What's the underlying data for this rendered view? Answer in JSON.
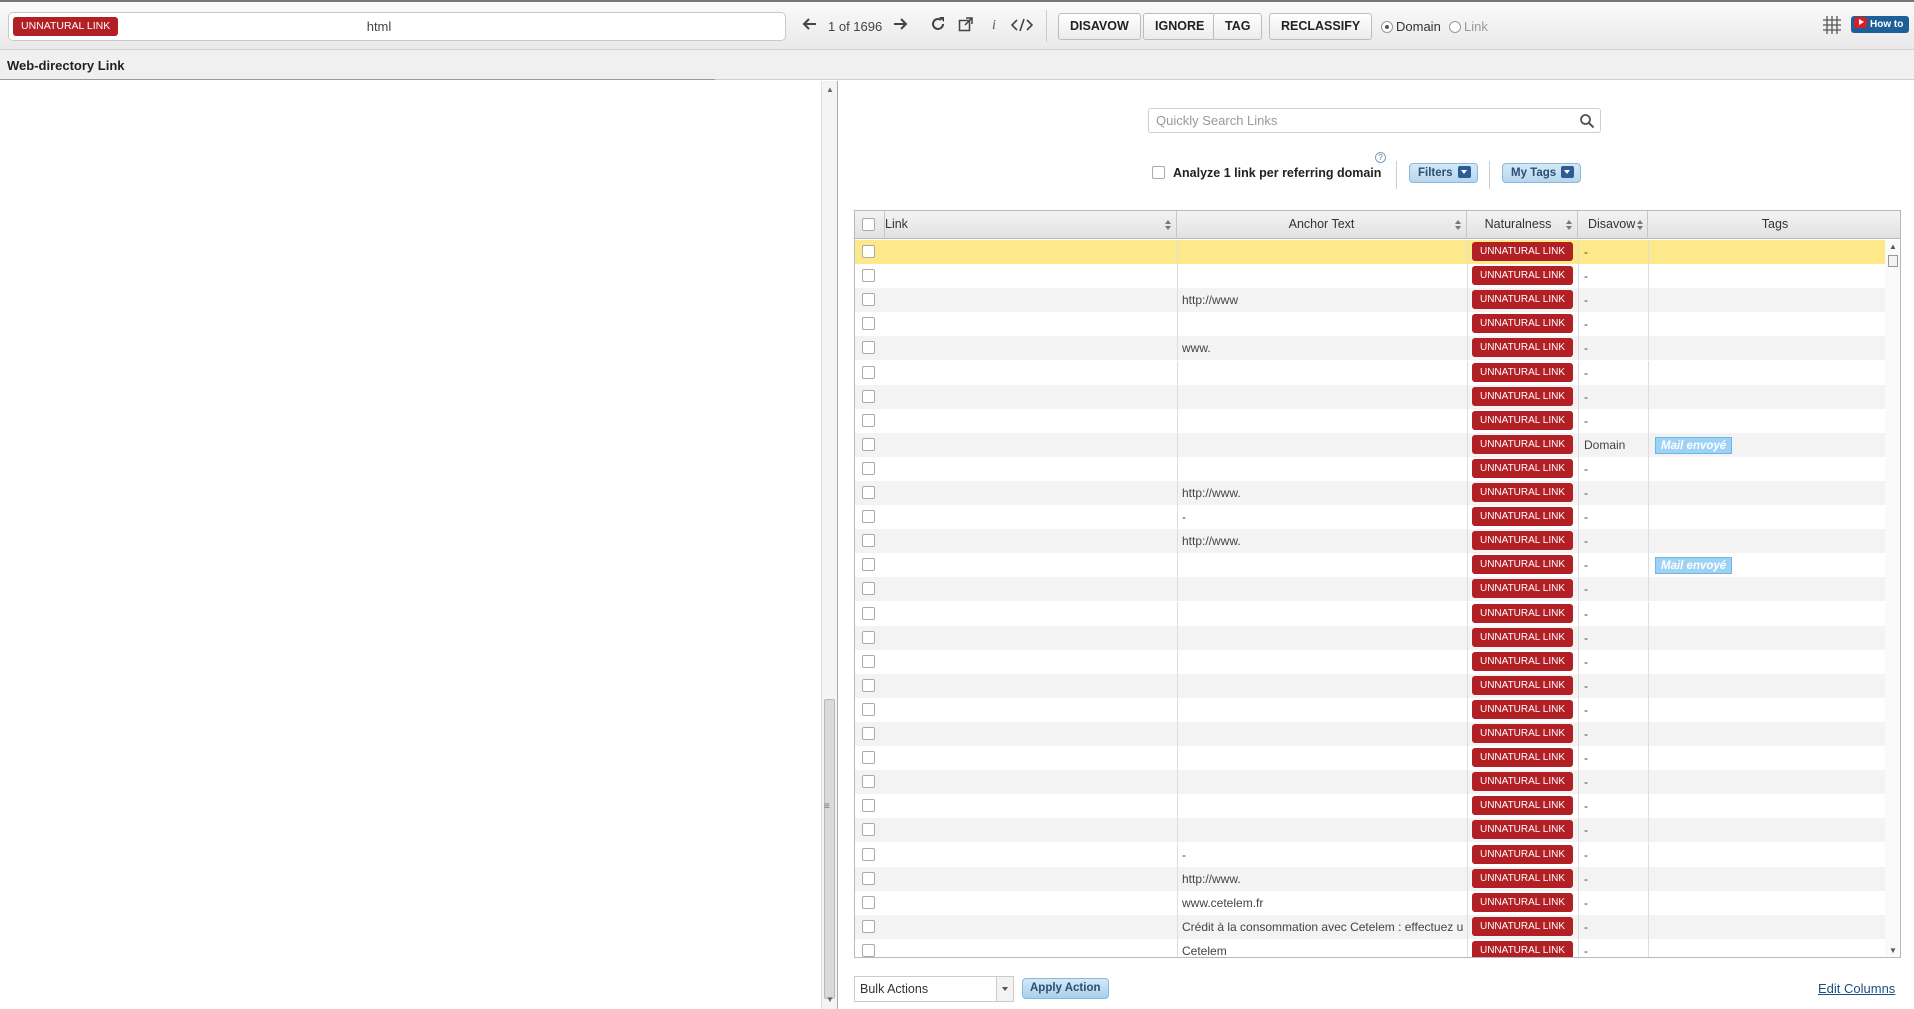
{
  "toolbar": {
    "url_badge": "UNNATURAL LINK",
    "url_text": "html",
    "pager": "1 of 1696",
    "buttons": {
      "disavow": "DISAVOW",
      "ignore": "IGNORE",
      "tag": "TAG",
      "reclassify": "RECLASSIFY"
    },
    "radio_domain": "Domain",
    "radio_link": "Link",
    "radio_selected": "Domain",
    "howto": "How to"
  },
  "subheader": {
    "title": "Web-directory Link"
  },
  "search": {
    "placeholder": "Quickly Search Links"
  },
  "filters": {
    "analyze_label": "Analyze 1 link per referring domain",
    "analyze_checked": false,
    "help": "?",
    "filters_button": "Filters",
    "mytags_button": "My Tags"
  },
  "table": {
    "columns": {
      "link": "Link",
      "anchor": "Anchor Text",
      "naturalness": "Naturalness",
      "disavow": "Disavow",
      "tags": "Tags"
    },
    "rows": [
      {
        "anchor": "",
        "naturalness": "UNNATURAL LINK",
        "disavow": "-",
        "tag": ""
      },
      {
        "anchor": "",
        "naturalness": "UNNATURAL LINK",
        "disavow": "-",
        "tag": ""
      },
      {
        "anchor": "http://www",
        "naturalness": "UNNATURAL LINK",
        "disavow": "-",
        "tag": ""
      },
      {
        "anchor": "",
        "naturalness": "UNNATURAL LINK",
        "disavow": "-",
        "tag": ""
      },
      {
        "anchor": "www.",
        "naturalness": "UNNATURAL LINK",
        "disavow": "-",
        "tag": ""
      },
      {
        "anchor": "",
        "naturalness": "UNNATURAL LINK",
        "disavow": "-",
        "tag": ""
      },
      {
        "anchor": "",
        "naturalness": "UNNATURAL LINK",
        "disavow": "-",
        "tag": ""
      },
      {
        "anchor": "",
        "naturalness": "UNNATURAL LINK",
        "disavow": "-",
        "tag": ""
      },
      {
        "anchor": "",
        "naturalness": "UNNATURAL LINK",
        "disavow": "Domain",
        "tag": "Mail envoyé"
      },
      {
        "anchor": "",
        "naturalness": "UNNATURAL LINK",
        "disavow": "-",
        "tag": ""
      },
      {
        "anchor": "http://www.",
        "naturalness": "UNNATURAL LINK",
        "disavow": "-",
        "tag": ""
      },
      {
        "anchor": "-",
        "naturalness": "UNNATURAL LINK",
        "disavow": "-",
        "tag": ""
      },
      {
        "anchor": "http://www.",
        "naturalness": "UNNATURAL LINK",
        "disavow": "-",
        "tag": ""
      },
      {
        "anchor": "",
        "naturalness": "UNNATURAL LINK",
        "disavow": "-",
        "tag": "Mail envoyé"
      },
      {
        "anchor": "",
        "naturalness": "UNNATURAL LINK",
        "disavow": "-",
        "tag": ""
      },
      {
        "anchor": "",
        "naturalness": "UNNATURAL LINK",
        "disavow": "-",
        "tag": ""
      },
      {
        "anchor": "",
        "naturalness": "UNNATURAL LINK",
        "disavow": "-",
        "tag": ""
      },
      {
        "anchor": "",
        "naturalness": "UNNATURAL LINK",
        "disavow": "-",
        "tag": ""
      },
      {
        "anchor": "",
        "naturalness": "UNNATURAL LINK",
        "disavow": "-",
        "tag": ""
      },
      {
        "anchor": "",
        "naturalness": "UNNATURAL LINK",
        "disavow": "-",
        "tag": ""
      },
      {
        "anchor": "",
        "naturalness": "UNNATURAL LINK",
        "disavow": "-",
        "tag": ""
      },
      {
        "anchor": "",
        "naturalness": "UNNATURAL LINK",
        "disavow": "-",
        "tag": ""
      },
      {
        "anchor": "",
        "naturalness": "UNNATURAL LINK",
        "disavow": "-",
        "tag": ""
      },
      {
        "anchor": "",
        "naturalness": "UNNATURAL LINK",
        "disavow": "-",
        "tag": ""
      },
      {
        "anchor": "",
        "naturalness": "UNNATURAL LINK",
        "disavow": "-",
        "tag": ""
      },
      {
        "anchor": "-",
        "naturalness": "UNNATURAL LINK",
        "disavow": "-",
        "tag": ""
      },
      {
        "anchor": "http://www.",
        "naturalness": "UNNATURAL LINK",
        "disavow": "-",
        "tag": ""
      },
      {
        "anchor": "www.cetelem.fr",
        "naturalness": "UNNATURAL LINK",
        "disavow": "-",
        "tag": ""
      },
      {
        "anchor": "Crédit à la consommation avec Cetelem : effectuez u",
        "naturalness": "UNNATURAL LINK",
        "disavow": "-",
        "tag": ""
      },
      {
        "anchor": "Cetelem",
        "naturalness": "UNNATURAL LINK",
        "disavow": "-",
        "tag": ""
      }
    ]
  },
  "footer": {
    "bulk_actions": "Bulk Actions",
    "apply_action": "Apply Action",
    "edit_columns": "Edit Columns"
  },
  "colors": {
    "unnatural": "#b21f24",
    "highlight_row": "#fde989",
    "tag_badge": "#9dd2f4",
    "link": "#1d4f82"
  }
}
